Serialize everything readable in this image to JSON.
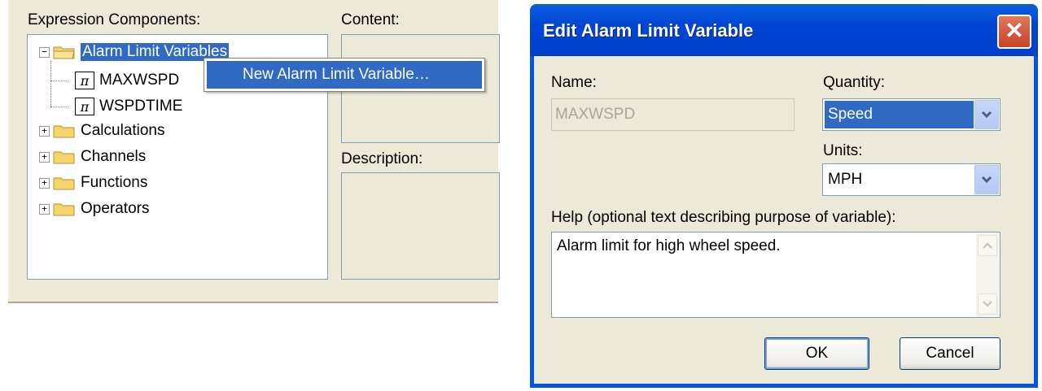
{
  "left": {
    "expression_components_label": "Expression Components:",
    "content_label": "Content:",
    "description_label": "Description:",
    "tree": {
      "root": {
        "label": "Alarm Limit Variables",
        "expander": "−"
      },
      "children": [
        {
          "label": "MAXWSPD",
          "icon": "pi-icon",
          "glyph": "π"
        },
        {
          "label": "WSPDTIME",
          "icon": "pi-icon",
          "glyph": "π"
        }
      ],
      "folders": [
        {
          "label": "Calculations",
          "expander": "+"
        },
        {
          "label": "Channels",
          "expander": "+"
        },
        {
          "label": "Functions",
          "expander": "+"
        },
        {
          "label": "Operators",
          "expander": "+"
        }
      ]
    },
    "context_menu": {
      "item": "New Alarm Limit Variable…"
    }
  },
  "dialog": {
    "title": "Edit Alarm Limit Variable",
    "close_glyph": "✕",
    "name_label": "Name:",
    "name_value": "MAXWSPD",
    "quantity_label": "Quantity:",
    "quantity_value": "Speed",
    "units_label": "Units:",
    "units_value": "MPH",
    "help_label": "Help (optional text describing purpose of variable):",
    "help_value": "Alarm limit for high wheel speed.",
    "ok_label": "OK",
    "cancel_label": "Cancel"
  },
  "colors": {
    "selection": "#316ac5",
    "title_bar": "#0055e5",
    "window_face": "#ece9d8"
  }
}
